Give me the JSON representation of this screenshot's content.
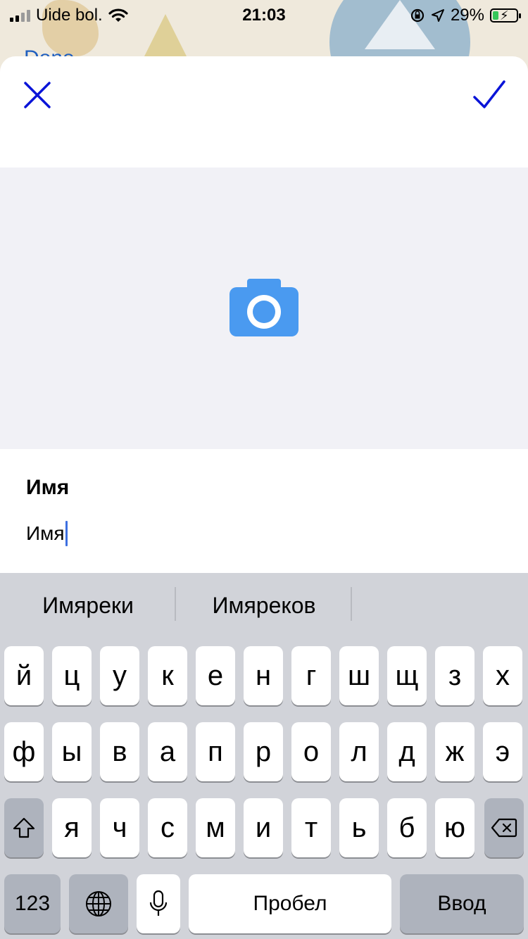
{
  "status_bar": {
    "carrier": "Uide bol.",
    "time": "21:03",
    "battery": "29%"
  },
  "background_app": {
    "done_label": "Done"
  },
  "sheet": {
    "close_icon": "close-x-icon",
    "confirm_icon": "checkmark-icon",
    "photo_icon": "camera-icon",
    "accent_color": "#0a14d8",
    "camera_color": "#4a9af0",
    "field": {
      "label": "Имя",
      "value": "Имя"
    }
  },
  "keyboard": {
    "suggestions": [
      "Имяреки",
      "Имяреков"
    ],
    "row1": [
      "й",
      "ц",
      "у",
      "к",
      "е",
      "н",
      "г",
      "ш",
      "щ",
      "з",
      "х"
    ],
    "row2": [
      "ф",
      "ы",
      "в",
      "а",
      "п",
      "р",
      "о",
      "л",
      "д",
      "ж",
      "э"
    ],
    "row3": [
      "я",
      "ч",
      "с",
      "м",
      "и",
      "т",
      "ь",
      "б",
      "ю"
    ],
    "numbers_label": "123",
    "space_label": "Пробел",
    "return_label": "Ввод"
  }
}
